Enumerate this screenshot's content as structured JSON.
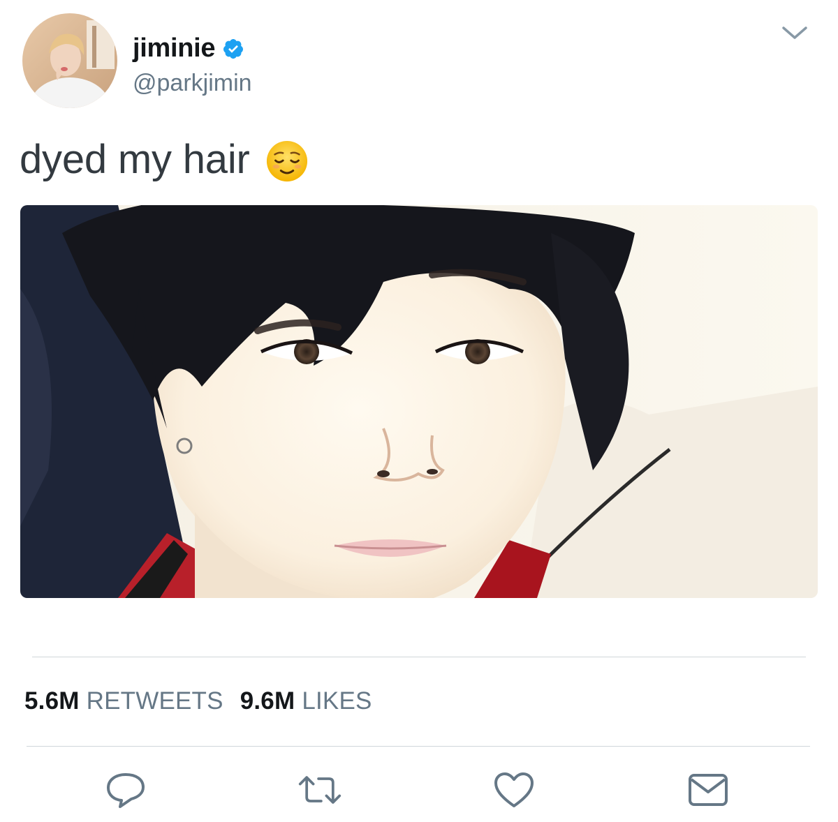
{
  "author": {
    "display_name": "jiminie",
    "handle": "@parkjimin",
    "verified": true,
    "verified_color": "#1da1f2"
  },
  "tweet": {
    "text": "dyed my hair",
    "emoji": "relieved-face-emoji"
  },
  "stats": {
    "retweets_count": "5.6M",
    "retweets_label": "RETWEETS",
    "likes_count": "9.6M",
    "likes_label": "LIKES"
  },
  "actions": [
    {
      "icon": "reply-icon"
    },
    {
      "icon": "retweet-icon"
    },
    {
      "icon": "like-icon"
    },
    {
      "icon": "direct-message-icon"
    }
  ],
  "colors": {
    "text_primary": "#14171a",
    "text_secondary": "#657786",
    "icon_gray": "#657786",
    "divider": "#d0d6da"
  }
}
